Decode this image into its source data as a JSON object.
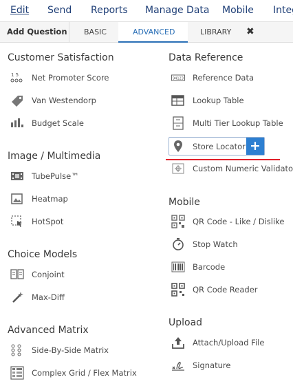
{
  "menu": {
    "edit": "Edit",
    "send": "Send",
    "reports": "Reports",
    "manage": "Manage Data",
    "mobile": "Mobile",
    "integ": "Integ"
  },
  "tabs": {
    "add_question": "Add Question",
    "basic": "BASIC",
    "advanced": "ADVANCED",
    "library": "LIBRARY",
    "close": "✖"
  },
  "left": {
    "customer_satisfaction": {
      "title": "Customer Satisfaction",
      "items": [
        "Net Promoter Score",
        "Van Westendorp",
        "Budget Scale"
      ]
    },
    "image_multimedia": {
      "title": "Image / Multimedia",
      "items": [
        "TubePulse™",
        "Heatmap",
        "HotSpot"
      ]
    },
    "choice_models": {
      "title": "Choice Models",
      "items": [
        "Conjoint",
        "Max-Diff"
      ]
    },
    "advanced_matrix": {
      "title": "Advanced Matrix",
      "items": [
        "Side-By-Side Matrix",
        "Complex Grid / Flex Matrix"
      ]
    }
  },
  "right": {
    "data_reference": {
      "title": "Data Reference",
      "items": [
        "Reference Data",
        "Lookup Table",
        "Multi Tier Lookup Table",
        "Store Locator",
        "Custom Numeric Validator"
      ],
      "add_symbol": "+"
    },
    "mobile": {
      "title": "Mobile",
      "items": [
        "QR Code - Like / Dislike",
        "Stop Watch",
        "Barcode",
        "QR Code Reader"
      ]
    },
    "upload": {
      "title": "Upload",
      "items": [
        "Attach/Upload File",
        "Signature"
      ]
    }
  },
  "icon_text": {
    "nps": "1  5",
    "ref": "94123"
  },
  "colors": {
    "menu_text": "#1f3f77",
    "active_tab": "#2a6fb6",
    "plus_button": "#2d7fd1",
    "highlight_underline": "#e0202a"
  }
}
